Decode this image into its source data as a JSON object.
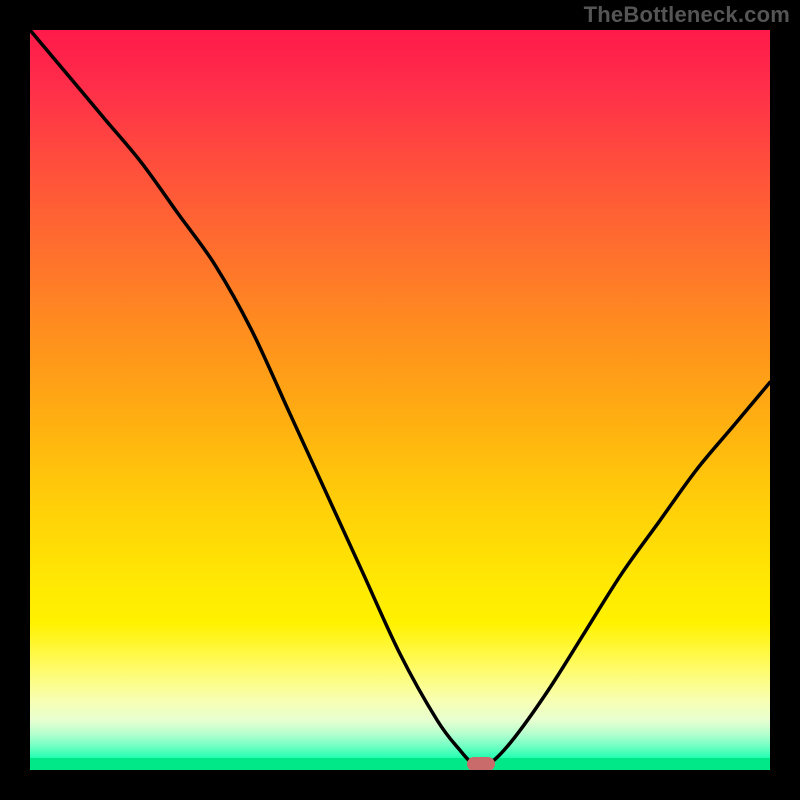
{
  "watermark": "TheBottleneck.com",
  "colors": {
    "background": "#000000",
    "curve_stroke": "#000000",
    "marker_fill": "#c96b6b",
    "green_line": "#00e887"
  },
  "chart_data": {
    "type": "line",
    "title": "",
    "xlabel": "",
    "ylabel": "",
    "xlim": [
      0,
      100
    ],
    "ylim": [
      0,
      100
    ],
    "x": [
      0,
      5,
      10,
      15,
      20,
      25,
      30,
      35,
      40,
      45,
      50,
      55,
      58,
      60,
      62,
      65,
      70,
      75,
      80,
      85,
      90,
      95,
      100
    ],
    "values": [
      100,
      94,
      88,
      82,
      75,
      68,
      59,
      48,
      37,
      26,
      15,
      6,
      2,
      0,
      0,
      3,
      10,
      18,
      26,
      33,
      40,
      46,
      52
    ],
    "marker": {
      "x": 61,
      "y": 0
    },
    "background_gradient": {
      "orientation": "vertical",
      "stops": [
        {
          "pos": 0,
          "color": "#ff1a4a"
        },
        {
          "pos": 30,
          "color": "#ff6a30"
        },
        {
          "pos": 60,
          "color": "#ffc80a"
        },
        {
          "pos": 85,
          "color": "#fff200"
        },
        {
          "pos": 97,
          "color": "#e8ffd0"
        },
        {
          "pos": 100,
          "color": "#00e887"
        }
      ]
    }
  }
}
